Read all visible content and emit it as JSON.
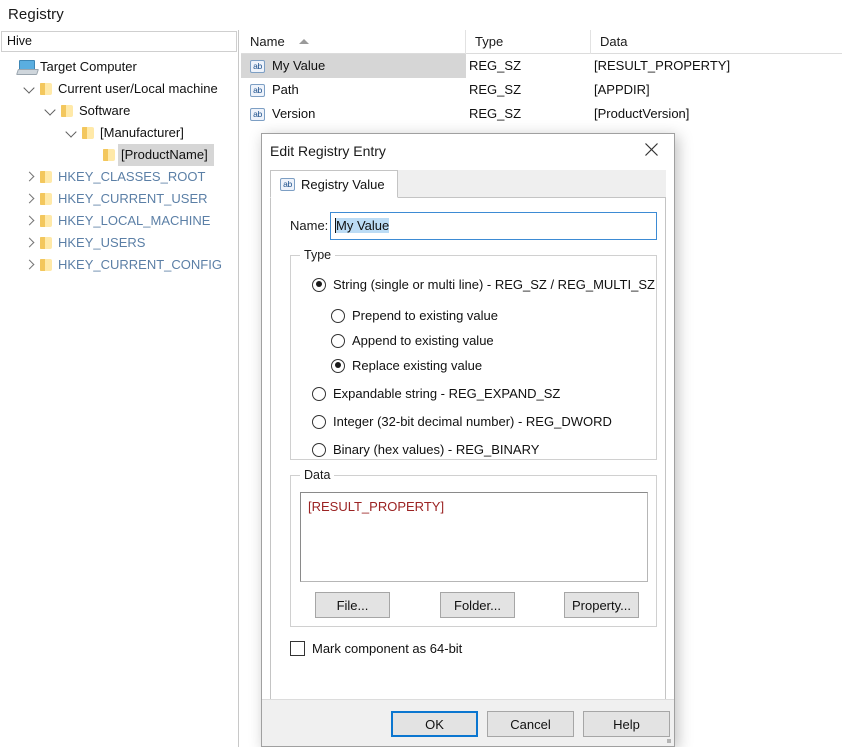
{
  "page": {
    "title": "Registry"
  },
  "tree": {
    "header": "Hive",
    "items": [
      {
        "label": "Target Computer",
        "icon": "computer-icon",
        "indent": 0,
        "chev": "none",
        "style": "normal",
        "selected": false
      },
      {
        "label": "Current user/Local machine",
        "icon": "folder-icon",
        "indent": 1,
        "chev": "open",
        "style": "normal",
        "selected": false
      },
      {
        "label": "Software",
        "icon": "folder-icon",
        "indent": 2,
        "chev": "open",
        "style": "normal",
        "selected": false
      },
      {
        "label": "[Manufacturer]",
        "icon": "folder-icon",
        "indent": 3,
        "chev": "open",
        "style": "normal",
        "selected": false
      },
      {
        "label": "[ProductName]",
        "icon": "folder-icon",
        "indent": 4,
        "chev": "none",
        "style": "normal",
        "selected": true
      },
      {
        "label": "HKEY_CLASSES_ROOT",
        "icon": "folder-icon",
        "indent": 1,
        "chev": "closed",
        "style": "hkey",
        "selected": false
      },
      {
        "label": "HKEY_CURRENT_USER",
        "icon": "folder-icon",
        "indent": 1,
        "chev": "closed",
        "style": "hkey",
        "selected": false
      },
      {
        "label": "HKEY_LOCAL_MACHINE",
        "icon": "folder-icon",
        "indent": 1,
        "chev": "closed",
        "style": "hkey",
        "selected": false
      },
      {
        "label": "HKEY_USERS",
        "icon": "folder-icon",
        "indent": 1,
        "chev": "closed",
        "style": "hkey",
        "selected": false
      },
      {
        "label": "HKEY_CURRENT_CONFIG",
        "icon": "folder-icon",
        "indent": 1,
        "chev": "closed",
        "style": "hkey",
        "selected": false
      }
    ]
  },
  "listview": {
    "columns": [
      "Name",
      "Type",
      "Data"
    ],
    "sorted_column": "Name",
    "sort_direction": "ascending",
    "rows": [
      {
        "name": "My Value",
        "type": "REG_SZ",
        "data": "[RESULT_PROPERTY]",
        "icon": "ab-icon",
        "selected": true
      },
      {
        "name": "Path",
        "type": "REG_SZ",
        "data": "[APPDIR]",
        "icon": "ab-icon",
        "selected": false
      },
      {
        "name": "Version",
        "type": "REG_SZ",
        "data": "[ProductVersion]",
        "icon": "ab-icon",
        "selected": false
      }
    ]
  },
  "dialog": {
    "title": "Edit Registry Entry",
    "close_icon": "close-icon",
    "tab": {
      "label": "Registry Value",
      "icon": "ab-icon"
    },
    "name_field": {
      "label": "Name:",
      "value": "My Value",
      "selected": true
    },
    "type_group": {
      "title": "Type",
      "options": [
        {
          "label": "String (single or multi line) - REG_SZ / REG_MULTI_SZ",
          "checked": true,
          "sub": false
        },
        {
          "label": "Prepend to existing value",
          "checked": false,
          "sub": true
        },
        {
          "label": "Append to existing value",
          "checked": false,
          "sub": true
        },
        {
          "label": "Replace existing value",
          "checked": true,
          "sub": true
        },
        {
          "label": "Expandable string - REG_EXPAND_SZ",
          "checked": false,
          "sub": false
        },
        {
          "label": "Integer (32-bit decimal number) - REG_DWORD",
          "checked": false,
          "sub": false
        },
        {
          "label": "Binary (hex values) - REG_BINARY",
          "checked": false,
          "sub": false
        }
      ]
    },
    "data_group": {
      "title": "Data",
      "value": "[RESULT_PROPERTY]",
      "value_color": "#9b2323",
      "buttons": [
        "File...",
        "Folder...",
        "Property..."
      ]
    },
    "checkbox": {
      "label": "Mark component as 64-bit",
      "checked": false
    },
    "footer_buttons": [
      {
        "label": "OK",
        "default": true
      },
      {
        "label": "Cancel",
        "default": false
      },
      {
        "label": "Help",
        "default": false
      }
    ]
  },
  "colors": {
    "accent": "#0b76d0",
    "selection": "#d6d6d6",
    "text_selection": "#bcdcf5",
    "hkey_text": "#5b7fa6",
    "data_value": "#9b2323"
  }
}
